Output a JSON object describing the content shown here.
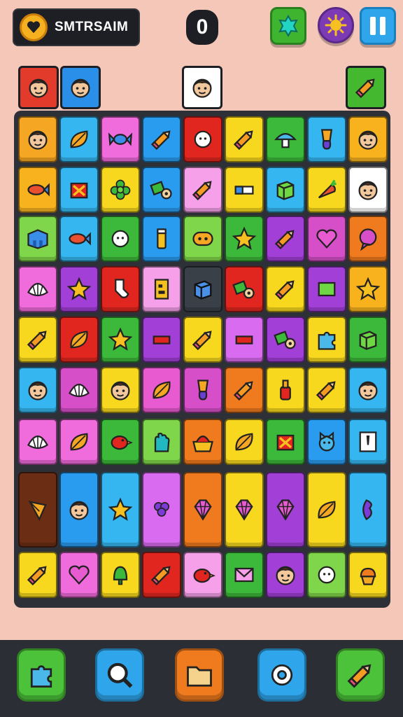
{
  "header": {
    "title": "SMTRSAIM",
    "score": "0",
    "coin_icon": "heart-icon",
    "buttons": [
      {
        "name": "gem-button",
        "icon": "gem-icon"
      },
      {
        "name": "daily-button",
        "icon": "sun-icon"
      },
      {
        "name": "pause-button",
        "icon": "pause-icon"
      }
    ]
  },
  "queue": [
    {
      "icon": "face-icon",
      "color": "#e23b2b"
    },
    {
      "icon": "face-icon",
      "color": "#2a8fe8"
    },
    {
      "icon": "face-icon",
      "color": "#ffffff"
    },
    {
      "icon": "pencil-icon",
      "color": "#44b82f"
    }
  ],
  "board": {
    "rows": [
      [
        {
          "icon": "face-icon",
          "color": "#f5a623"
        },
        {
          "icon": "leaf-icon",
          "color": "#35b6f0"
        },
        {
          "icon": "candy-icon",
          "color": "#f06bdc"
        },
        {
          "icon": "pencil-icon",
          "color": "#2a9cf0"
        },
        {
          "icon": "ball-icon",
          "color": "#e0261f"
        },
        {
          "icon": "pencil-icon",
          "color": "#f7d81e"
        },
        {
          "icon": "mushroom-icon",
          "color": "#3cb83a"
        },
        {
          "icon": "brush-icon",
          "color": "#35b6f0"
        },
        {
          "icon": "face-icon",
          "color": "#f7b21e"
        }
      ],
      [
        {
          "icon": "fish-icon",
          "color": "#f7b21e"
        },
        {
          "icon": "gift-icon",
          "color": "#35b6f0"
        },
        {
          "icon": "flower-icon",
          "color": "#f7d81e"
        },
        {
          "icon": "tape-icon",
          "color": "#2a9cf0"
        },
        {
          "icon": "pencil-icon",
          "color": "#f5a0e8"
        },
        {
          "icon": "eraser-icon",
          "color": "#f7d81e"
        },
        {
          "icon": "box-icon",
          "color": "#35b6f0"
        },
        {
          "icon": "carrot-icon",
          "color": "#f7d81e"
        },
        {
          "icon": "face-icon",
          "color": "#ffffff"
        }
      ],
      [
        {
          "icon": "block-icon",
          "color": "#7fd64a"
        },
        {
          "icon": "fish-icon",
          "color": "#35b6f0"
        },
        {
          "icon": "ball-icon",
          "color": "#3cb83a"
        },
        {
          "icon": "tube-icon",
          "color": "#2a9cf0"
        },
        {
          "icon": "eyes-icon",
          "color": "#7fd64a"
        },
        {
          "icon": "star-icon",
          "color": "#3cb83a"
        },
        {
          "icon": "pencil-icon",
          "color": "#a13fd6"
        },
        {
          "icon": "heart-icon",
          "color": "#d64fc9"
        },
        {
          "icon": "bubble-icon",
          "color": "#f07a1e"
        }
      ],
      [
        {
          "icon": "shell-icon",
          "color": "#f06bdc"
        },
        {
          "icon": "star-icon",
          "color": "#a13fd6"
        },
        {
          "icon": "sock-icon",
          "color": "#e0261f"
        },
        {
          "icon": "letter-icon",
          "color": "#f5a0e8"
        },
        {
          "icon": "cube-icon",
          "color": "#3a4048"
        },
        {
          "icon": "tape-icon",
          "color": "#e0261f"
        },
        {
          "icon": "pencil-icon",
          "color": "#f7d81e"
        },
        {
          "icon": "square-icon",
          "color": "#a13fd6"
        },
        {
          "icon": "star-icon",
          "color": "#f7b21e"
        }
      ],
      [
        {
          "icon": "pencil-icon",
          "color": "#f7d81e"
        },
        {
          "icon": "leaf-icon",
          "color": "#e0261f"
        },
        {
          "icon": "star-icon",
          "color": "#3cb83a"
        },
        {
          "icon": "bar-icon",
          "color": "#a13fd6"
        },
        {
          "icon": "pencil-icon",
          "color": "#f7d81e"
        },
        {
          "icon": "bar-icon",
          "color": "#d86bf0"
        },
        {
          "icon": "tape-icon",
          "color": "#a13fd6"
        },
        {
          "icon": "puzzle-icon",
          "color": "#f7d81e"
        },
        {
          "icon": "box-icon",
          "color": "#3cb83a"
        }
      ],
      [
        {
          "icon": "face-icon",
          "color": "#35b6f0"
        },
        {
          "icon": "shell-icon",
          "color": "#d64fc9"
        },
        {
          "icon": "face-icon",
          "color": "#f7d81e"
        },
        {
          "icon": "leaf-icon",
          "color": "#e75ad0"
        },
        {
          "icon": "brush-icon",
          "color": "#d64fc9"
        },
        {
          "icon": "pencil-icon",
          "color": "#f07a1e"
        },
        {
          "icon": "bottle-icon",
          "color": "#f7d81e"
        },
        {
          "icon": "pencil-icon",
          "color": "#f7d81e"
        },
        {
          "icon": "face-icon",
          "color": "#35b6f0"
        }
      ],
      [
        {
          "icon": "shell-icon",
          "color": "#f06bdc"
        },
        {
          "icon": "leaf-icon",
          "color": "#f06bdc"
        },
        {
          "icon": "bird-icon",
          "color": "#3cb83a"
        },
        {
          "icon": "hand-icon",
          "color": "#7fd64a"
        },
        {
          "icon": "basket-icon",
          "color": "#f07a1e"
        },
        {
          "icon": "leaf-icon",
          "color": "#f7d81e"
        },
        {
          "icon": "gift-icon",
          "color": "#3cb83a"
        },
        {
          "icon": "cat-icon",
          "color": "#2a9cf0"
        },
        {
          "icon": "note-icon",
          "color": "#35b6f0"
        }
      ],
      [
        {
          "icon": "kite-icon",
          "color": "#6b2e14"
        },
        {
          "icon": "face-icon",
          "color": "#2a9cf0"
        },
        {
          "icon": "star-icon",
          "color": "#35b6f0"
        },
        {
          "icon": "grape-icon",
          "color": "#d86bf0"
        },
        {
          "icon": "gem-icon",
          "color": "#f07a1e"
        },
        {
          "icon": "gem-icon",
          "color": "#f7d81e"
        },
        {
          "icon": "gem-icon",
          "color": "#a13fd6"
        },
        {
          "icon": "leaf-icon",
          "color": "#f7d81e"
        },
        {
          "icon": "wave-icon",
          "color": "#35b6f0"
        }
      ],
      [
        {
          "icon": "pencil-icon",
          "color": "#f7d81e"
        },
        {
          "icon": "heart-icon",
          "color": "#f06bdc"
        },
        {
          "icon": "bell-icon",
          "color": "#f7d81e"
        },
        {
          "icon": "pencil-icon",
          "color": "#e0261f"
        },
        {
          "icon": "bird-icon",
          "color": "#f5a0e8"
        },
        {
          "icon": "envelope-icon",
          "color": "#3cb83a"
        },
        {
          "icon": "face-icon",
          "color": "#a13fd6"
        },
        {
          "icon": "ball-icon",
          "color": "#7fd64a"
        },
        {
          "icon": "cupcake-icon",
          "color": "#f7d81e"
        }
      ]
    ]
  },
  "dock": [
    {
      "name": "shuffle-button",
      "icon": "puzzle-icon",
      "color": "#4cc23a"
    },
    {
      "name": "hint-button",
      "icon": "magnifier-icon",
      "color": "#2fa6ec"
    },
    {
      "name": "inventory-button",
      "icon": "folder-icon",
      "color": "#f07a1e"
    },
    {
      "name": "settings-button",
      "icon": "gear-icon",
      "color": "#2fa6ec"
    },
    {
      "name": "boost-button",
      "icon": "pencil-icon",
      "color": "#4cc23a"
    }
  ]
}
